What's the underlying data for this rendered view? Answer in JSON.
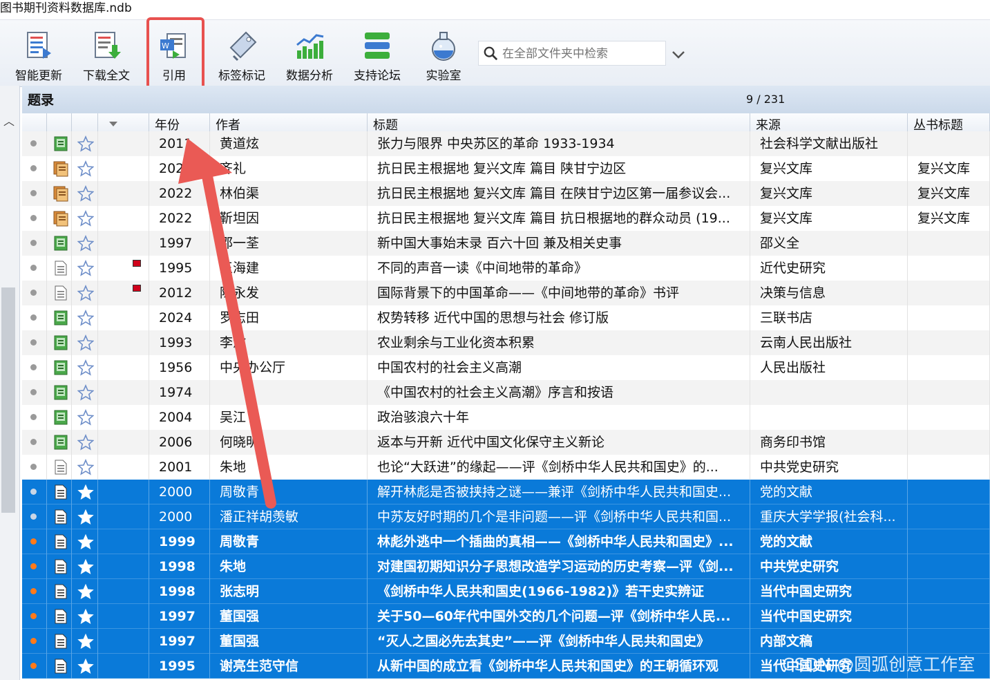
{
  "window": {
    "title": "图书期刊资料数据库.ndb"
  },
  "toolbar": {
    "buttons": [
      {
        "label": "智能更新",
        "icon": "smart-update-icon"
      },
      {
        "label": "下载全文",
        "icon": "download-fulltext-icon"
      },
      {
        "label": "引用",
        "icon": "cite-icon"
      },
      {
        "label": "标签标记",
        "icon": "tag-icon"
      },
      {
        "label": "数据分析",
        "icon": "chart-icon"
      },
      {
        "label": "支持论坛",
        "icon": "forum-icon"
      },
      {
        "label": "实验室",
        "icon": "flask-icon"
      }
    ],
    "search_placeholder": "在全部文件夹中检索"
  },
  "panel": {
    "title": "题录",
    "count": "9 / 231"
  },
  "columns": {
    "year": "年份",
    "author": "作者",
    "title": "标题",
    "source": "来源",
    "series": "丛书标题"
  },
  "rows": [
    {
      "year": "2011",
      "author": "黄道炫",
      "title": "张力与限界 中央苏区的革命 1933-1934",
      "source": "社会科学文献出版社",
      "series": "",
      "type": "book-icon",
      "flag": false,
      "sel": false,
      "unread": false
    },
    {
      "year": "2022",
      "author": "齐礼",
      "title": "抗日民主根据地 复兴文库 篇目 陕甘宁边区",
      "source": "复兴文库",
      "series": "复兴文库",
      "type": "series-icon",
      "flag": false,
      "sel": false,
      "unread": false
    },
    {
      "year": "2022",
      "author": "林伯渠",
      "title": "抗日民主根据地 复兴文库 篇目 在陕甘宁边区第一届参议会...",
      "source": "复兴文库",
      "series": "复兴文库",
      "type": "series-icon",
      "flag": false,
      "sel": false,
      "unread": false
    },
    {
      "year": "2022",
      "author": "靳坦因",
      "title": "抗日民主根据地 复兴文库 篇目 抗日根据地的群众动员 (19...",
      "source": "复兴文库",
      "series": "复兴文库",
      "type": "series-icon",
      "flag": false,
      "sel": false,
      "unread": false
    },
    {
      "year": "1997",
      "author": "邵一荃",
      "title": "新中国大事始末录 百六十回 兼及相关史事",
      "source": "邵义全",
      "series": "",
      "type": "book-icon",
      "flag": false,
      "sel": false,
      "unread": false
    },
    {
      "year": "1995",
      "author": "王海建",
      "title": "不同的声音一读《中间地带的革命》",
      "source": "近代史研究",
      "series": "",
      "type": "article-icon",
      "flag": true,
      "sel": false,
      "unread": false
    },
    {
      "year": "2012",
      "author": "陈永发",
      "title": "国际背景下的中国革命——《中间地带的革命》书评",
      "source": "决策与信息",
      "series": "",
      "type": "article-icon",
      "flag": true,
      "sel": false,
      "unread": false
    },
    {
      "year": "2024",
      "author": "罗志田",
      "title": "权势转移 近代中国的思想与社会 修订版",
      "source": "三联书店",
      "series": "",
      "type": "book-icon",
      "flag": false,
      "sel": false,
      "unread": false
    },
    {
      "year": "1993",
      "author": "李溦",
      "title": "农业剩余与工业化资本积累",
      "source": "云南人民出版社",
      "series": "",
      "type": "book-icon",
      "flag": false,
      "sel": false,
      "unread": false
    },
    {
      "year": "1956",
      "author": "中央办公厅",
      "title": "中国农村的社会主义高潮",
      "source": "人民出版社",
      "series": "",
      "type": "book-icon",
      "flag": false,
      "sel": false,
      "unread": false
    },
    {
      "year": "1974",
      "author": "",
      "title": "《中国农村的社会主义高潮》序言和按语",
      "source": "",
      "series": "",
      "type": "book-icon",
      "flag": false,
      "sel": false,
      "unread": false
    },
    {
      "year": "2004",
      "author": "吴江",
      "title": "政治骇浪六十年",
      "source": "",
      "series": "",
      "type": "book-icon",
      "flag": false,
      "sel": false,
      "unread": false
    },
    {
      "year": "2006",
      "author": "何晓明",
      "title": "返本与开新 近代中国文化保守主义新论",
      "source": "商务印书馆",
      "series": "",
      "type": "book-icon",
      "flag": false,
      "sel": false,
      "unread": false
    },
    {
      "year": "2001",
      "author": "朱地",
      "title": "也论“大跃进”的缘起——评《剑桥中华人民共和国史》的...",
      "source": "中共党史研究",
      "series": "",
      "type": "article-icon",
      "flag": false,
      "sel": false,
      "unread": false
    },
    {
      "year": "2000",
      "author": "周敬青",
      "title": "解开林彪是否被挟持之谜——兼评《剑桥中华人民共和国史...",
      "source": "党的文献",
      "series": "",
      "type": "article-icon",
      "flag": false,
      "sel": true,
      "unread": false
    },
    {
      "year": "2000",
      "author": "潘正祥胡羡敏",
      "title": "中苏友好时期的几个是非问题——评《剑桥中华人民共和国...",
      "source": "重庆大学学报(社会科...",
      "series": "",
      "type": "article-icon",
      "flag": false,
      "sel": true,
      "unread": false
    },
    {
      "year": "1999",
      "author": "周敬青",
      "title": "林彪外逃中一个插曲的真相——《剑桥中华人民共和国史》...",
      "source": "党的文献",
      "series": "",
      "type": "article-icon",
      "flag": false,
      "sel": true,
      "unread": true
    },
    {
      "year": "1998",
      "author": "朱地",
      "title": "对建国初期知识分子思想改造学习运动的历史考察—评《剑...",
      "source": "中共党史研究",
      "series": "",
      "type": "article-icon",
      "flag": false,
      "sel": true,
      "unread": true
    },
    {
      "year": "1998",
      "author": "张志明",
      "title": "《剑桥中华人民共和国史(1966-1982)》若干史实辨证",
      "source": "当代中国史研究",
      "series": "",
      "type": "article-icon",
      "flag": false,
      "sel": true,
      "unread": true
    },
    {
      "year": "1997",
      "author": "董国强",
      "title": "关于50—60年代中国外交的几个问题—评《剑桥中华人民...",
      "source": "当代中国史研究",
      "series": "",
      "type": "article-icon",
      "flag": false,
      "sel": true,
      "unread": true
    },
    {
      "year": "1997",
      "author": "董国强",
      "title": "“灭人之国必先去其史”——评《剑桥中华人民共和国史》",
      "source": "内部文稿",
      "series": "",
      "type": "article-icon",
      "flag": false,
      "sel": true,
      "unread": true
    },
    {
      "year": "1995",
      "author": "谢亮生范守信",
      "title": "从新中国的成立看《剑桥中华人民共和国史》的王朝循环观",
      "source": "当代中国史研究",
      "series": "",
      "type": "article-icon",
      "flag": false,
      "sel": true,
      "unread": true
    }
  ],
  "watermark": "CSDN @圆弧创意工作室",
  "colors": {
    "selection": "#0a7ad9",
    "annotation": "#e8514f",
    "unread": "#ff7a1a"
  }
}
